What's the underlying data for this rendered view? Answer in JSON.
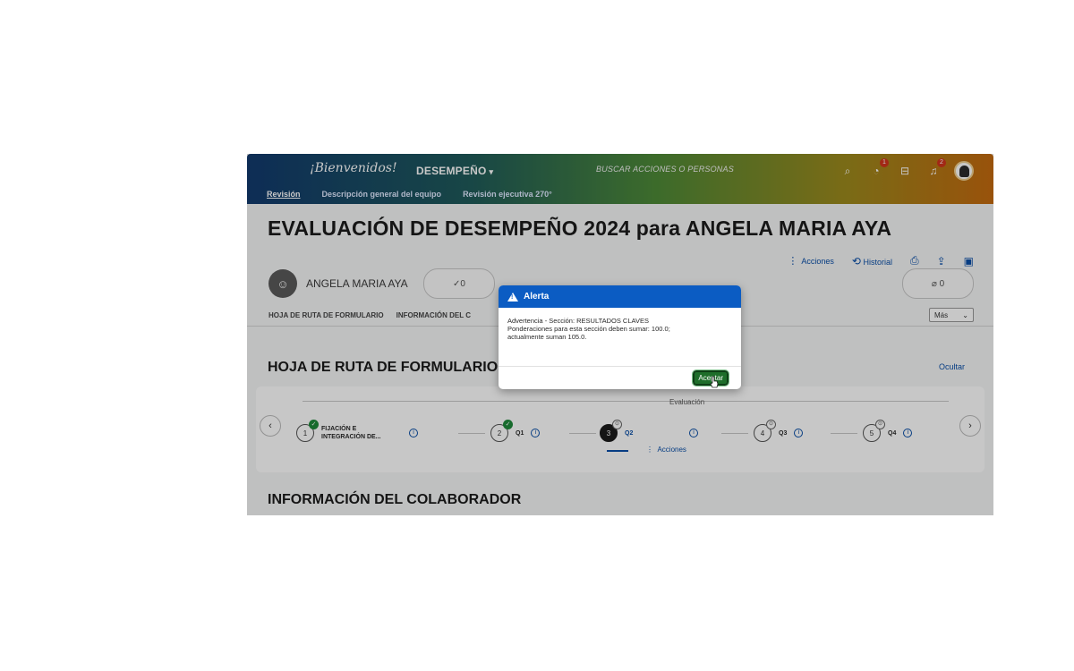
{
  "header": {
    "logo": "¡Bienvenidos!",
    "module": "DESEMPEÑO",
    "search_placeholder": "BUSCAR ACCIONES O PERSONAS",
    "badge_tasks": "1",
    "badge_notifications": "2"
  },
  "subnav": [
    "Revisión",
    "Descripción general del equipo",
    "Revisión ejecutiva 270°"
  ],
  "page": {
    "title": "EVALUACIÓN DE DESEMPEÑO 2024 para ANGELA MARIA AYA",
    "toolbar": {
      "actions": "Acciones",
      "history": "Historial"
    },
    "employee_name": "ANGELA MARIA AYA",
    "rating_left": "✓0",
    "rating_right": "0",
    "sections": [
      "HOJA DE RUTA DE FORMULARIO",
      "INFORMACIÓN DEL C"
    ],
    "more": "Más",
    "route_title": "HOJA DE RUTA DE FORMULARIO",
    "hide": "Ocultar",
    "evaluation_label": "Evaluación",
    "steps": [
      {
        "num": "1",
        "label": "FIJACIÓN E INTEGRACIÓN DE..."
      },
      {
        "num": "2",
        "label": "Q1"
      },
      {
        "num": "3",
        "label": "Q2"
      },
      {
        "num": "4",
        "label": "Q3"
      },
      {
        "num": "5",
        "label": "Q4"
      }
    ],
    "step_actions": "Acciones",
    "collab_title": "INFORMACIÓN DEL COLABORADOR"
  },
  "dialog": {
    "title": "Alerta",
    "line1": "Advertencia - Sección: RESULTADOS CLAVES",
    "line2": "Ponderaciones para esta sección deben sumar: 100.0;",
    "line3": "actualmente suman 105.0.",
    "ok": "Aceptar"
  }
}
